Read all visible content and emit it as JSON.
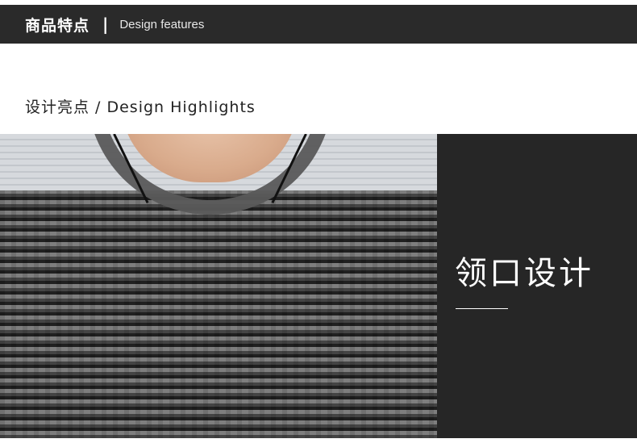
{
  "header": {
    "title": "商品特点",
    "separator": "|",
    "subtitle": "Design features"
  },
  "section": {
    "title": "设计亮点 / Design Highlights"
  },
  "feature": {
    "title": "领口设计"
  },
  "colors": {
    "header_bg": "#2a2a2a",
    "panel_bg": "#262626",
    "text_light": "#ffffff",
    "text_dark": "#222222"
  }
}
